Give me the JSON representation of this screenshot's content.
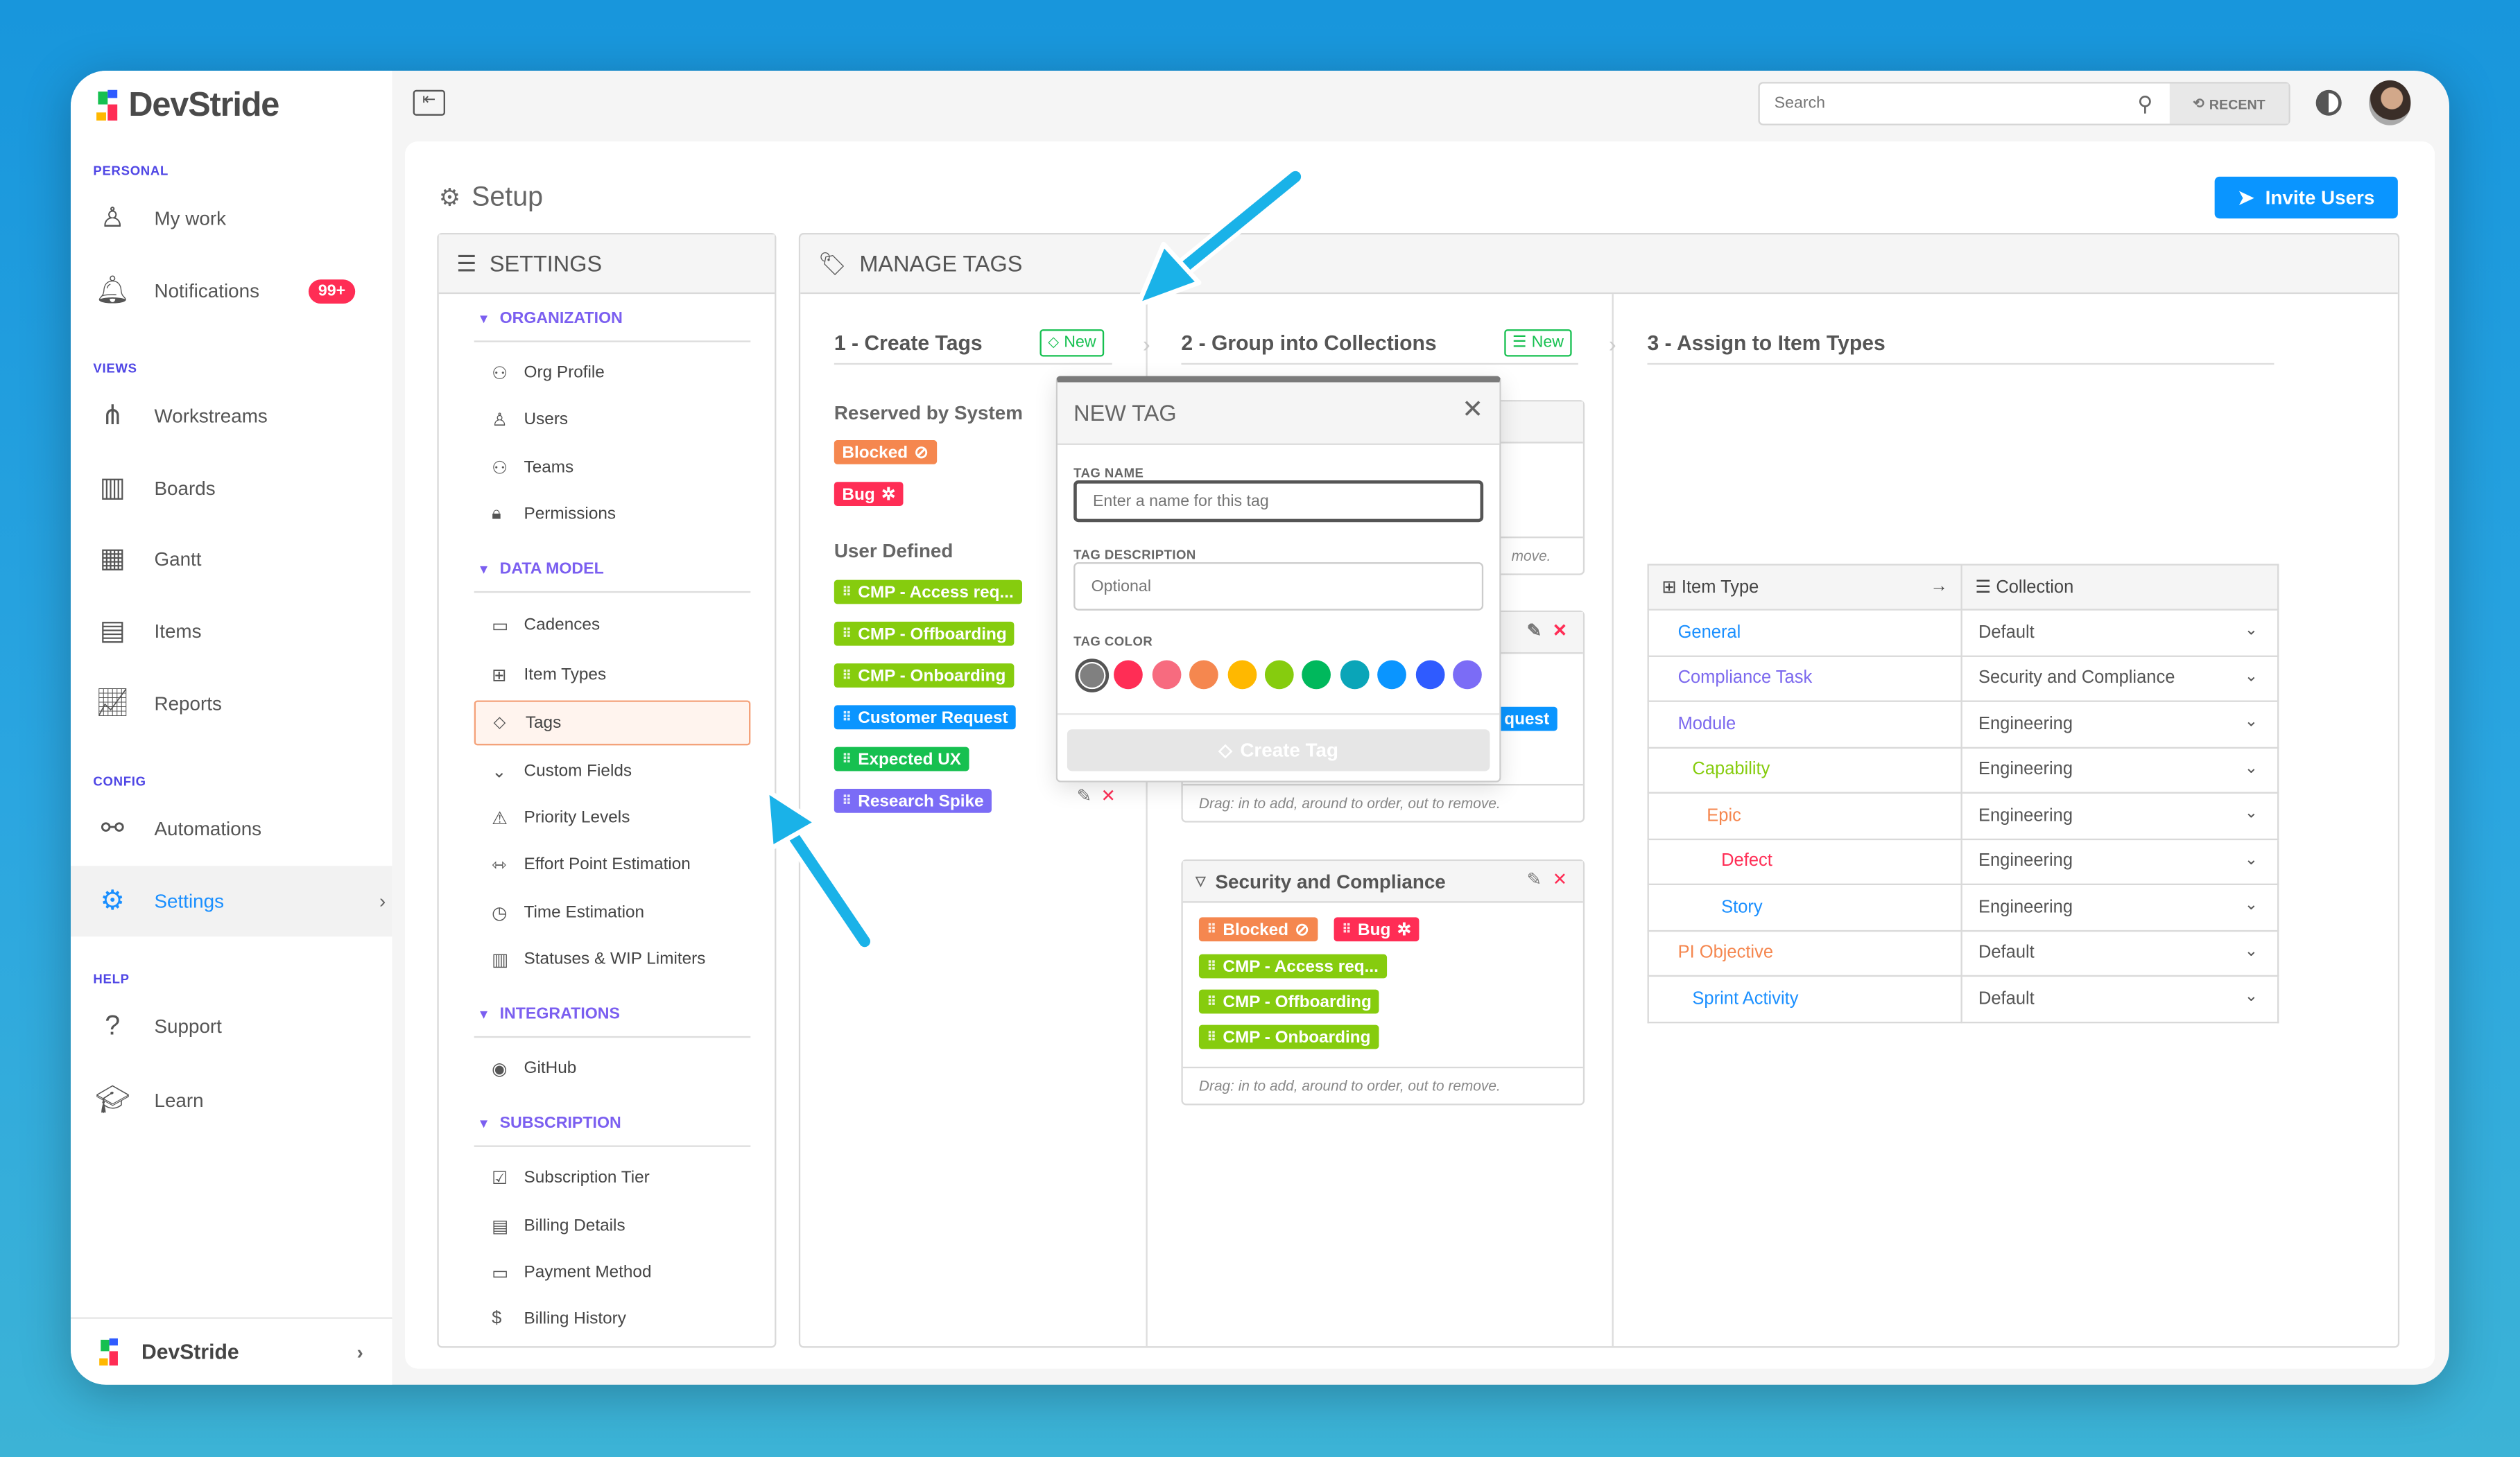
{
  "app": {
    "name": "DevStride"
  },
  "sidebar": {
    "sections": [
      {
        "label": "PERSONAL"
      },
      {
        "label": "VIEWS"
      },
      {
        "label": "CONFIG"
      },
      {
        "label": "HELP"
      }
    ],
    "items": [
      {
        "label": "My work",
        "icon": "user-icon"
      },
      {
        "label": "Notifications",
        "icon": "bell-icon",
        "badge": "99+"
      },
      {
        "label": "Workstreams",
        "icon": "workstreams-icon"
      },
      {
        "label": "Boards",
        "icon": "boards-icon"
      },
      {
        "label": "Gantt",
        "icon": "gantt-icon"
      },
      {
        "label": "Items",
        "icon": "items-icon"
      },
      {
        "label": "Reports",
        "icon": "reports-icon"
      },
      {
        "label": "Automations",
        "icon": "automations-icon"
      },
      {
        "label": "Settings",
        "icon": "gear-icon",
        "active": true
      },
      {
        "label": "Support",
        "icon": "help-icon"
      },
      {
        "label": "Learn",
        "icon": "graduation-cap-icon"
      }
    ],
    "footer": {
      "label": "DevStride"
    }
  },
  "topbar": {
    "search_placeholder": "Search",
    "recent_label": "RECENT"
  },
  "page": {
    "title": "Setup",
    "invite_label": "Invite Users"
  },
  "settings": {
    "title": "SETTINGS",
    "groups": [
      {
        "label": "ORGANIZATION",
        "items": [
          "Org Profile",
          "Users",
          "Teams",
          "Permissions"
        ]
      },
      {
        "label": "DATA MODEL",
        "items": [
          "Cadences",
          "Item Types",
          "Tags",
          "Custom Fields",
          "Priority Levels",
          "Effort Point Estimation",
          "Time Estimation",
          "Statuses & WIP Limiters"
        ]
      },
      {
        "label": "INTEGRATIONS",
        "items": [
          "GitHub"
        ]
      },
      {
        "label": "SUBSCRIPTION",
        "items": [
          "Subscription Tier",
          "Billing Details",
          "Payment Method",
          "Billing History"
        ]
      }
    ],
    "active_item": "Tags"
  },
  "manage": {
    "title": "MANAGE TAGS",
    "step1": {
      "title": "1 - Create Tags",
      "new_label": "New",
      "reserved_label": "Reserved by System",
      "user_label": "User Defined",
      "reserved": [
        {
          "label": "Blocked",
          "color": "#f5874f",
          "icon": "blocked-icon"
        },
        {
          "label": "Bug",
          "color": "#ff2d55",
          "icon": "bug-icon"
        }
      ],
      "user": [
        {
          "label": "CMP - Access req...",
          "color": "#86cc0e"
        },
        {
          "label": "CMP - Offboarding",
          "color": "#86cc0e"
        },
        {
          "label": "CMP - Onboarding",
          "color": "#86cc0e"
        },
        {
          "label": "Customer Request",
          "color": "#0a95ff"
        },
        {
          "label": "Expected UX",
          "color": "#16c050"
        },
        {
          "label": "Research Spike",
          "color": "#7b6cf6"
        }
      ]
    },
    "step2": {
      "title": "2 - Group into Collections",
      "new_label": "New",
      "hint_partial": "move.",
      "partial_tag": "quest",
      "hint": "Drag: in to add, around to order, out to remove.",
      "collection": {
        "name": "Security and Compliance",
        "tags": [
          {
            "label": "Blocked",
            "color": "#f5874f"
          },
          {
            "label": "Bug",
            "color": "#ff2d55"
          },
          {
            "label": "CMP - Access req...",
            "color": "#86cc0e"
          },
          {
            "label": "CMP - Offboarding",
            "color": "#86cc0e"
          },
          {
            "label": "CMP - Onboarding",
            "color": "#86cc0e"
          }
        ]
      }
    },
    "step3": {
      "title": "3 - Assign to Item Types",
      "col_item_type": "Item Type",
      "col_collection": "Collection",
      "rows": [
        {
          "type": "General",
          "color": "#1a8fff",
          "collection": "Default"
        },
        {
          "type": "Compliance Task",
          "color": "#7b68ee",
          "collection": "Security and Compliance"
        },
        {
          "type": "Module",
          "color": "#7b68ee",
          "collection": "Engineering"
        },
        {
          "type": "Capability",
          "color": "#86cc0e",
          "collection": "Engineering"
        },
        {
          "type": "Epic",
          "color": "#f5874f",
          "collection": "Engineering"
        },
        {
          "type": "Defect",
          "color": "#ff2d55",
          "collection": "Engineering"
        },
        {
          "type": "Story",
          "color": "#1a8fff",
          "collection": "Engineering"
        },
        {
          "type": "PI Objective",
          "color": "#f5874f",
          "collection": "Default"
        },
        {
          "type": "Sprint Activity",
          "color": "#1a8fff",
          "collection": "Default"
        }
      ]
    }
  },
  "modal": {
    "title": "NEW TAG",
    "name_label": "TAG NAME",
    "name_placeholder": "Enter a name for this tag",
    "desc_label": "TAG DESCRIPTION",
    "desc_placeholder": "Optional",
    "color_label": "TAG COLOR",
    "colors": [
      "#808080",
      "#ff2d55",
      "#f76b7f",
      "#f5874f",
      "#ffb800",
      "#86cc0e",
      "#00b85c",
      "#0aa5b8",
      "#0a95ff",
      "#2f5bff",
      "#7b6cf6"
    ],
    "selected_color": "#808080",
    "create_label": "Create Tag"
  },
  "theme": {
    "accent": "#0a95ff",
    "section_label": "#4f46e5",
    "group_label": "#7b5ff0",
    "arrow": "#1ab2e8"
  }
}
